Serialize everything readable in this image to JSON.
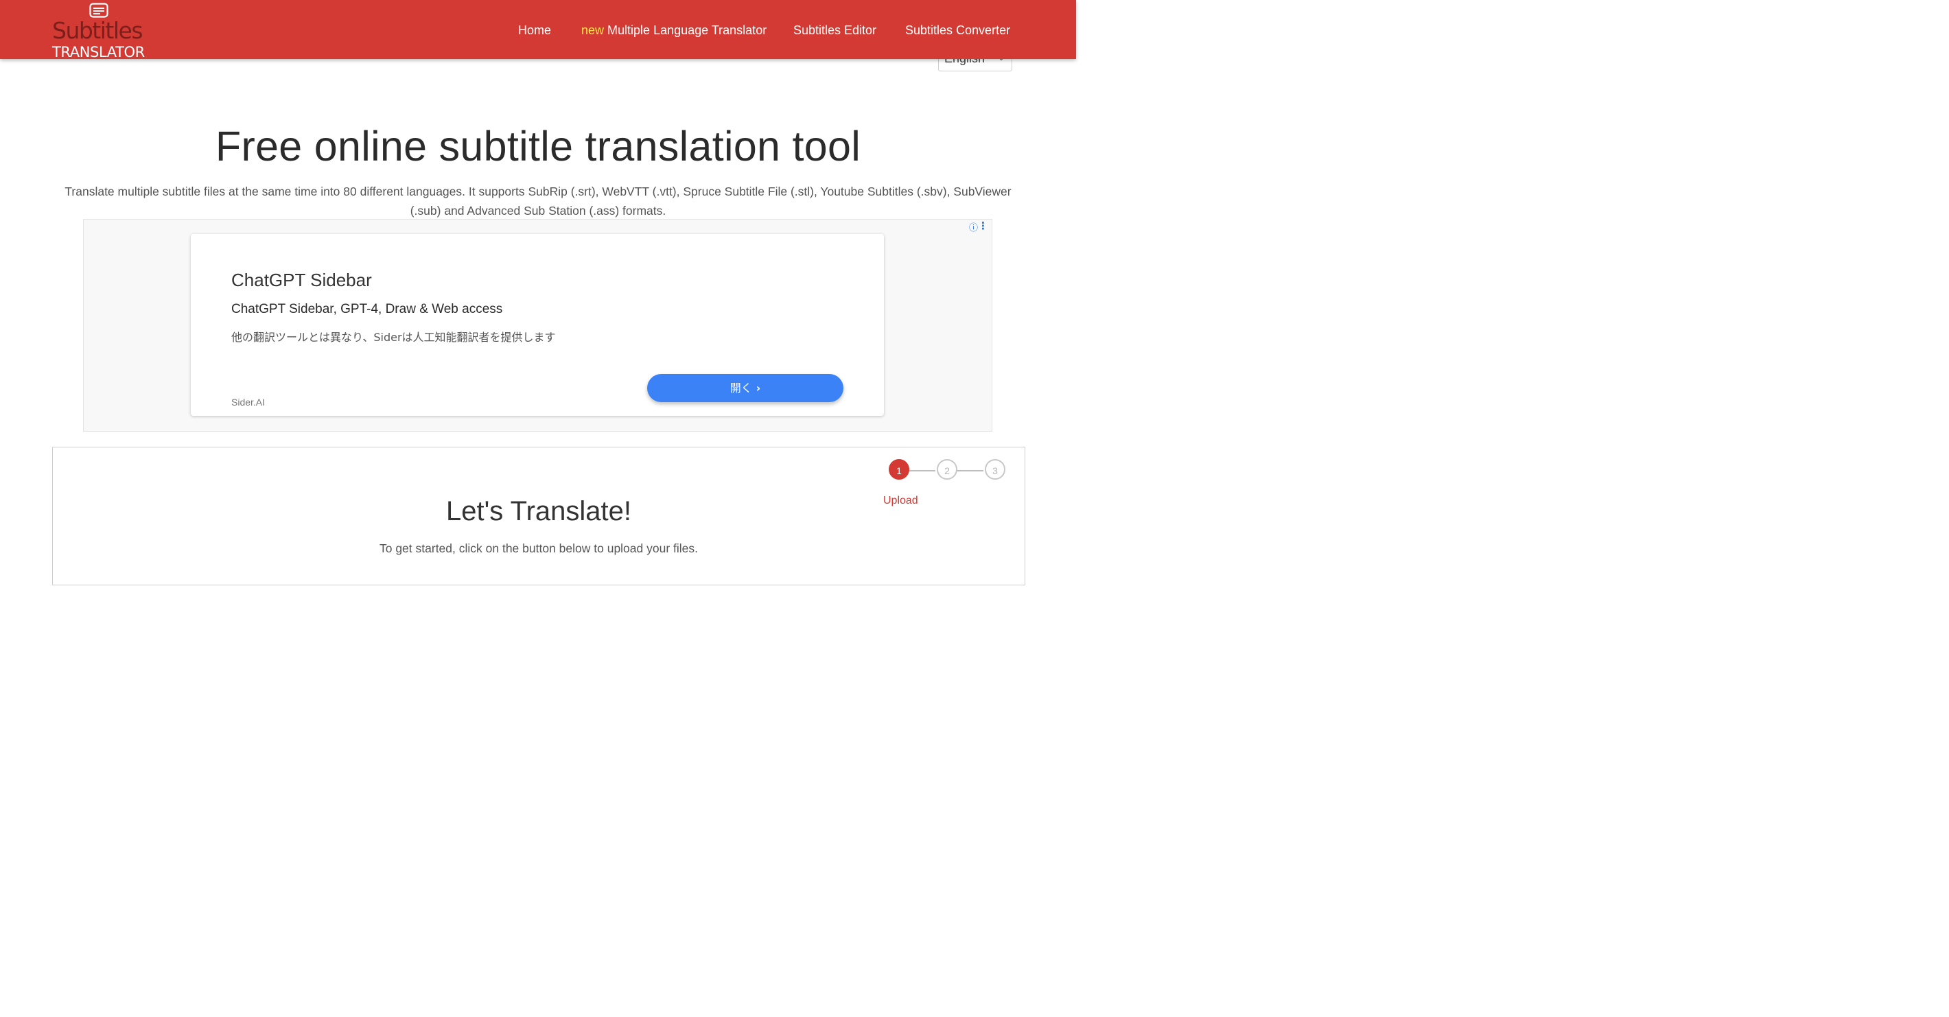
{
  "header": {
    "logo_line1": "Subtitles",
    "logo_line2": "TRANSLATOR",
    "nav": {
      "home": "Home",
      "new_badge": "new",
      "multi_translator": "Multiple Language Translator",
      "editor": "Subtitles Editor",
      "converter": "Subtitles Converter"
    },
    "colors": {
      "bar": "#d23a33",
      "new_badge": "#ffe54a"
    }
  },
  "language_select": {
    "value": "English"
  },
  "hero": {
    "title": "Free online subtitle translation tool",
    "description": "Translate multiple subtitle files at the same time into 80 different languages. It supports SubRip (.srt), WebVTT (.vtt), Spruce Subtitle File (.stl), Youtube Subtitles (.sbv), SubViewer (.sub) and Advanced Sub Station (.ass) formats."
  },
  "ad": {
    "title": "ChatGPT Sidebar",
    "subtitle": "ChatGPT Sidebar, GPT-4, Draw & Web access",
    "text": "他の翻訳ツールとは異なり、Siderは人工知能翻訳者を提供します",
    "domain": "Sider.AI",
    "button_label": "開く",
    "icons": [
      "info-icon",
      "more-vertical-icon",
      "chevron-right-icon"
    ]
  },
  "translate": {
    "title": "Let's Translate!",
    "description": "To get started, click on the button below to upload your files.",
    "steps": [
      "1",
      "2",
      "3"
    ],
    "active_step_label": "Upload",
    "accent": "#d23a33"
  }
}
